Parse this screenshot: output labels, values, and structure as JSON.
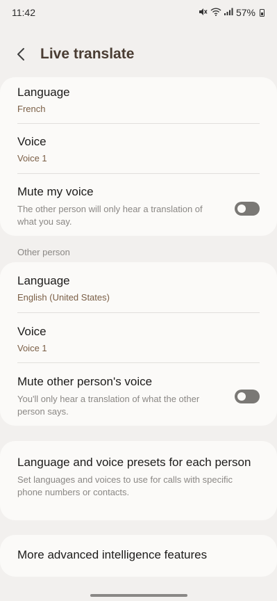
{
  "status": {
    "time": "11:42",
    "battery": "57%"
  },
  "header": {
    "title": "Live translate"
  },
  "my_card": {
    "language_title": "Language",
    "language_value": "French",
    "voice_title": "Voice",
    "voice_value": "Voice 1",
    "mute_title": "Mute my voice",
    "mute_desc": "The other person will only hear a translation of what you say.",
    "mute_on": false
  },
  "other_label": "Other person",
  "other_card": {
    "language_title": "Language",
    "language_value": "English (United States)",
    "voice_title": "Voice",
    "voice_value": "Voice 1",
    "mute_title": "Mute other person's voice",
    "mute_desc": "You'll only hear a translation of what the other person says.",
    "mute_on": false
  },
  "presets": {
    "title": "Language and voice presets for each person",
    "desc": "Set languages and voices to use for calls with specific phone numbers or contacts."
  },
  "advanced": {
    "title": "More advanced intelligence features"
  }
}
